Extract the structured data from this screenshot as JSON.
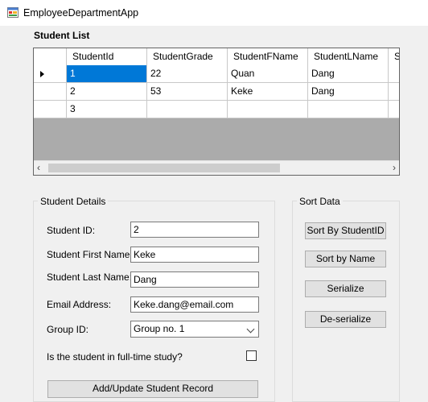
{
  "window": {
    "title": "EmployeeDepartmentApp",
    "icon": "winforms-app-icon"
  },
  "grid": {
    "title": "Student List",
    "columns": [
      "StudentId",
      "StudentGrade",
      "StudentFName",
      "StudentLName",
      "S"
    ],
    "rows": [
      [
        "1",
        "22",
        "Quan",
        "Dang"
      ],
      [
        "2",
        "53",
        "Keke",
        "Dang"
      ],
      [
        "3",
        "",
        "",
        ""
      ]
    ],
    "selected_row": 0,
    "selected_cell": "1"
  },
  "details": {
    "group_label": "Student Details",
    "student_id_label": "Student ID:",
    "student_id_value": "2",
    "first_name_label": "Student First Name:",
    "first_name_value": "Keke",
    "last_name_label": "Student Last Name:",
    "last_name_value": "Dang",
    "email_label": "Email Address:",
    "email_value": "Keke.dang@email.com",
    "group_id_label": "Group ID:",
    "group_id_value": "Group no. 1",
    "fulltime_label": "Is the student in full-time study?",
    "fulltime_checked": false,
    "submit_label": "Add/Update Student Record"
  },
  "sort": {
    "group_label": "Sort Data",
    "sort_by_id_label": "Sort By StudentID",
    "sort_by_name_label": "Sort by Name",
    "serialize_label": "Serialize",
    "deserialize_label": "De-serialize"
  },
  "colors": {
    "selection": "#0078d7",
    "grid_background": "#ababab",
    "window": "#f0f0f0"
  }
}
